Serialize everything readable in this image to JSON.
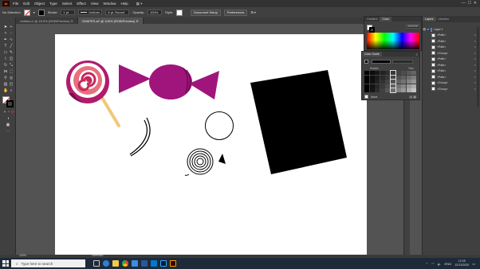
{
  "app": {
    "logo": "Ai",
    "menus": [
      "File",
      "Edit",
      "Object",
      "Type",
      "Select",
      "Effect",
      "View",
      "Window",
      "Help"
    ]
  },
  "control_bar": {
    "selection": "No Selection",
    "stroke_label": "Stroke:",
    "stroke_value": "1 pt",
    "uniform": "Uniform",
    "brush": "5 pt. Round",
    "opacity_label": "Opacity:",
    "opacity_value": "100%",
    "style_label": "Style:",
    "doc_setup": "Document Setup",
    "preferences": "Preferences"
  },
  "doc_tabs": [
    {
      "label": "Untitled-1 @ 18.5% (RGB/Preview)"
    },
    {
      "label": "SHAPES.ai* @ 100% (RGB/Preview)"
    }
  ],
  "color_panel": {
    "tabs": [
      "Gradient",
      "Color"
    ],
    "hex": "000000"
  },
  "swatch_panel": {
    "title": "Color Guide",
    "row_labels": [
      "Shades",
      "Tints"
    ],
    "footer": "None"
  },
  "layers_panel": {
    "tabs": [
      "Layers",
      "Libraries"
    ],
    "layer_name": "Layer 1",
    "rows": [
      "<Path>",
      "<Path>",
      "<Path>",
      "<Group>",
      "<Path>",
      "<Path>",
      "<Path>",
      "<Path>",
      "<Group>",
      "<Group>"
    ]
  },
  "status": {
    "zoom": "100%",
    "mode": "Selection"
  },
  "taskbar": {
    "search_placeholder": "Type here to search",
    "lang": "ENG",
    "time": "12:25",
    "date": "12/12/2020"
  }
}
